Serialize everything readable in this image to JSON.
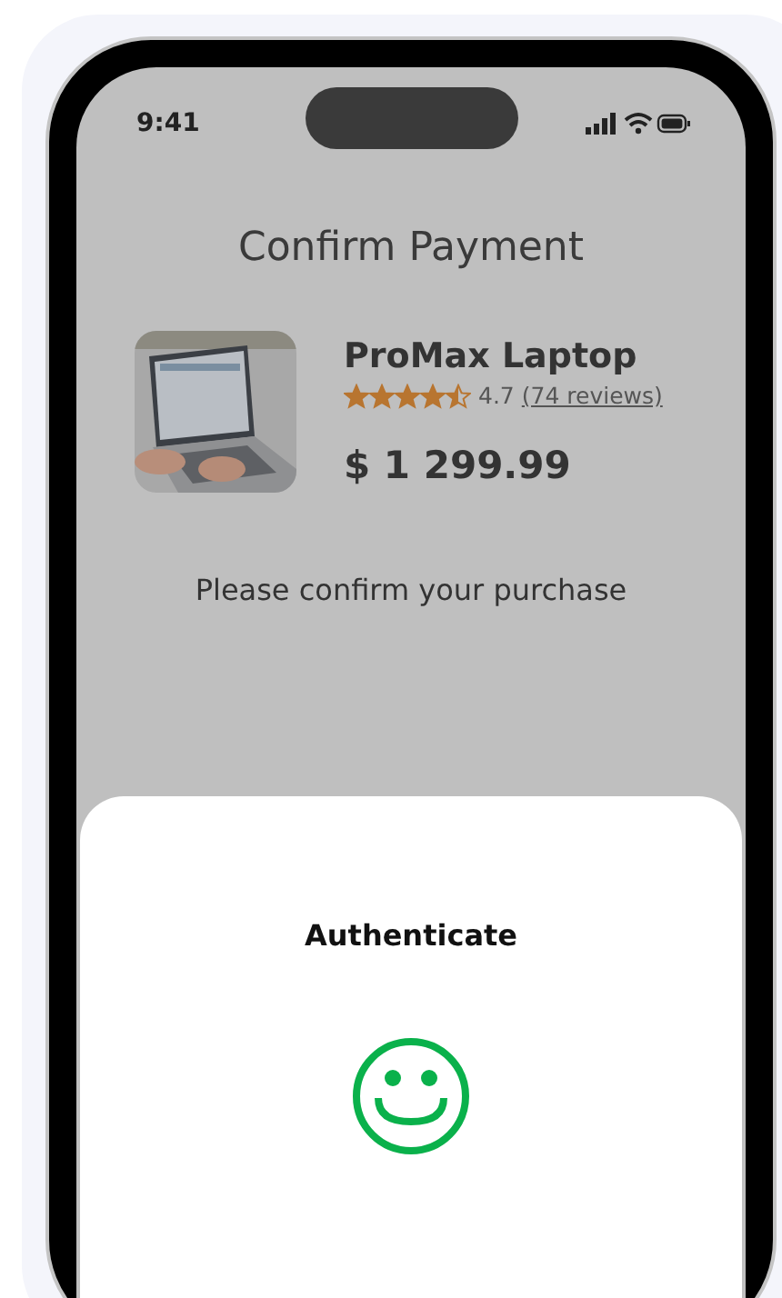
{
  "status_bar": {
    "time": "9:41"
  },
  "title": "Confirm Payment",
  "product": {
    "name": "ProMax Laptop",
    "stars": 4.5,
    "rating": "4.7",
    "reviews": "(74 reviews)",
    "price": "$ 1 299.99"
  },
  "prompt": "Please confirm your purchase",
  "sheet": {
    "title": "Authenticate"
  }
}
